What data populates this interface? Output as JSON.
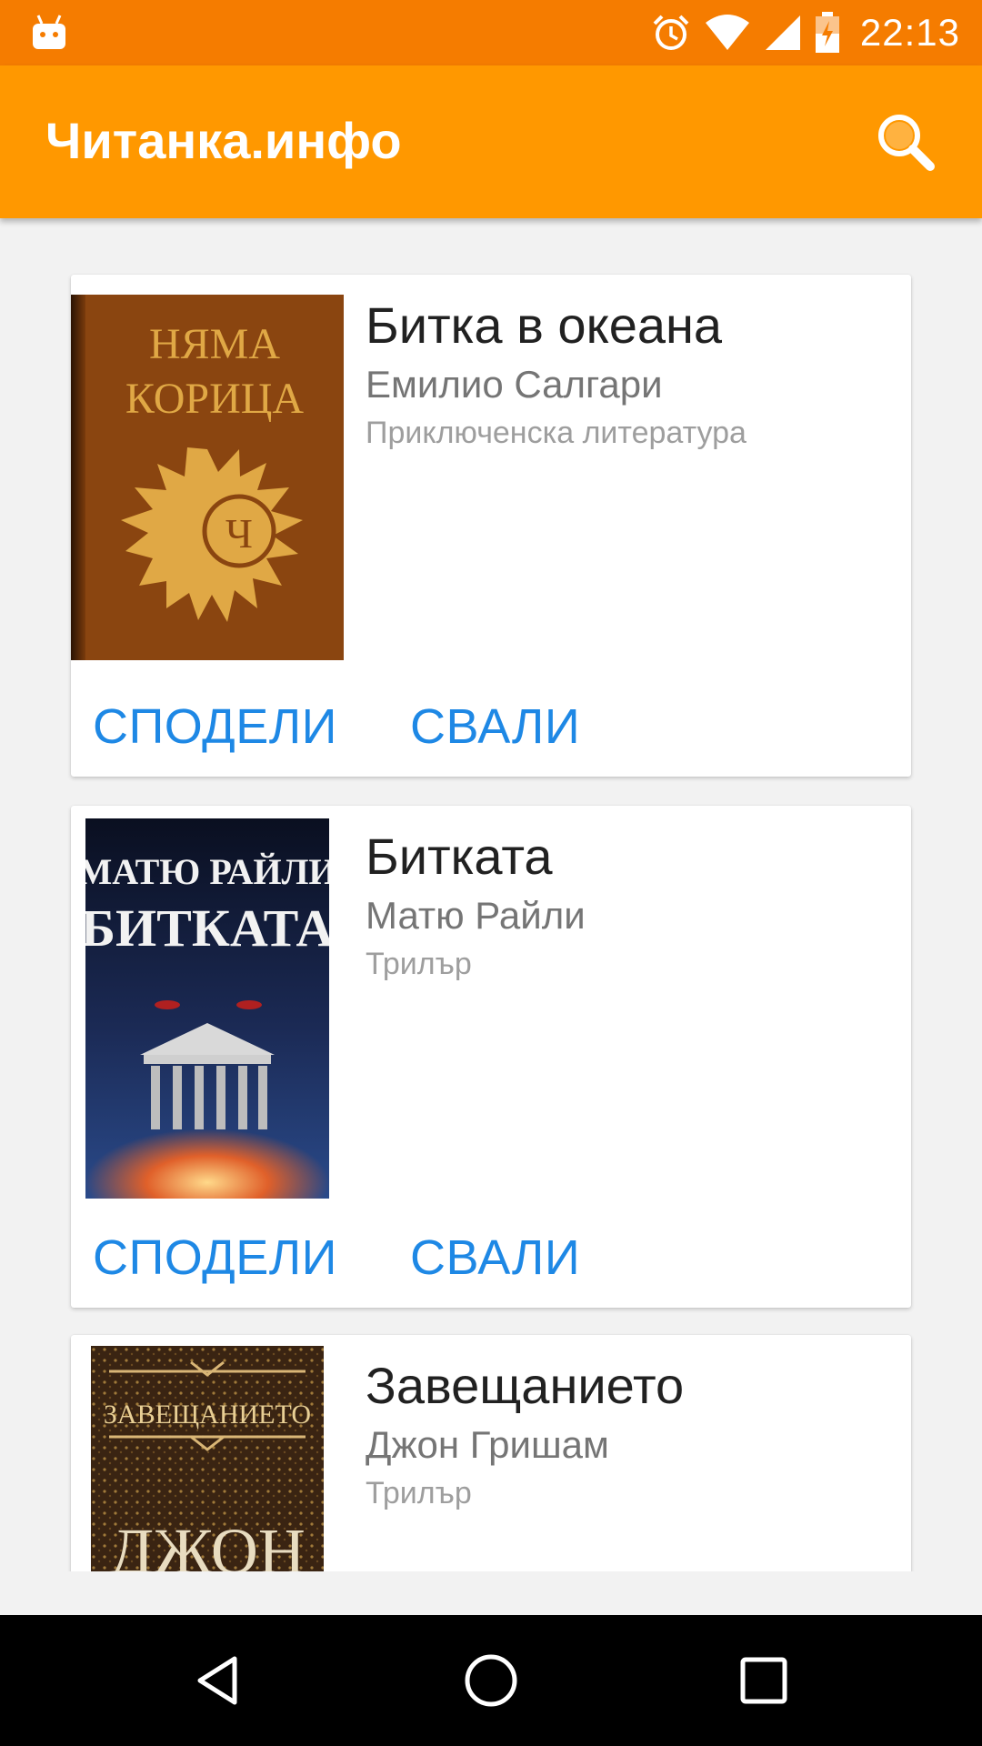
{
  "status_bar": {
    "time": "22:13",
    "icons": [
      "android-notification-icon",
      "alarm-icon",
      "wifi-icon",
      "signal-icon",
      "battery-charging-icon"
    ]
  },
  "app_bar": {
    "title": "Читанка.инфо",
    "search_icon": "search-icon"
  },
  "books": [
    {
      "title": "Битка в океана",
      "author": "Емилио Салгари",
      "genre": "Приключенска литература",
      "cover_text": [
        "НЯМА",
        "КОРИЦА",
        "Ч"
      ],
      "share_label": "СПОДЕЛИ",
      "download_label": "СВАЛИ"
    },
    {
      "title": "Битката",
      "author": "Матю Райли",
      "genre": "Трилър",
      "cover_text": [
        "МАТЮ РАЙЛИ",
        "БИТКАТА"
      ],
      "share_label": "СПОДЕЛИ",
      "download_label": "СВАЛИ"
    },
    {
      "title": "Завещанието",
      "author": "Джон Гришам",
      "genre": "Трилър",
      "cover_text": [
        "ЗАВЕЩАНИЕТО",
        "ДЖОН"
      ]
    }
  ],
  "nav_bar": {
    "icons": [
      "back-icon",
      "home-icon",
      "recents-icon"
    ]
  },
  "colors": {
    "status_bar": "#f57c00",
    "app_bar": "#ff9800",
    "action": "#1e88e5"
  }
}
